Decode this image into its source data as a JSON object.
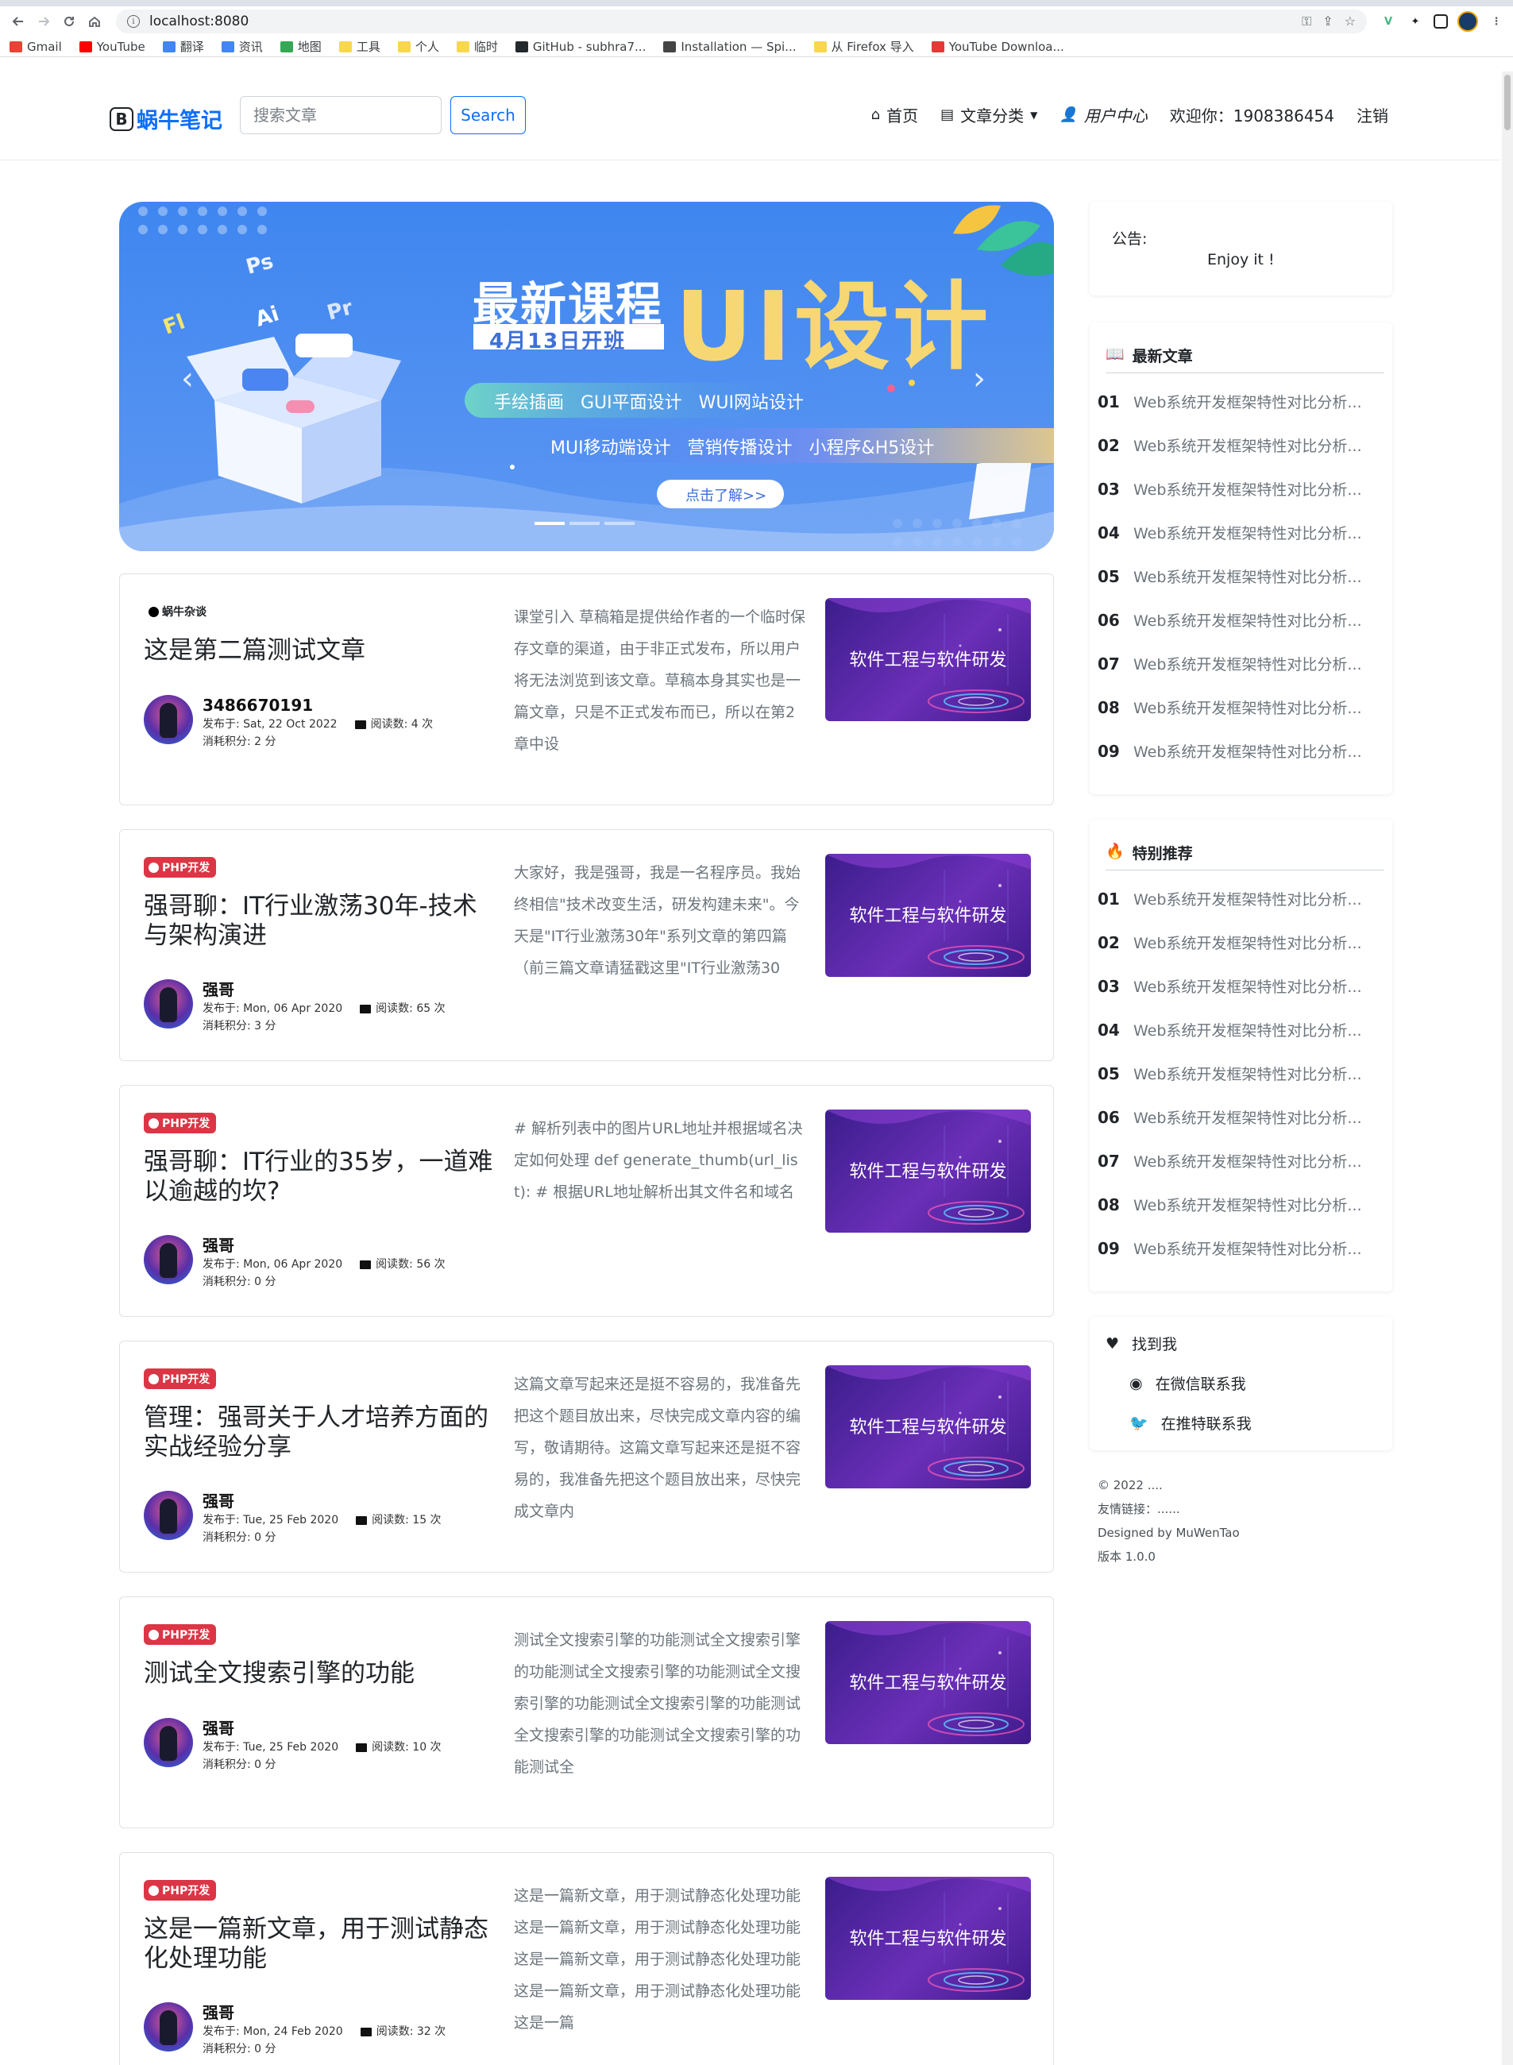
{
  "browser": {
    "url": "localhost:8080",
    "bookmarks": [
      {
        "label": "Gmail",
        "color": "#ea4335"
      },
      {
        "label": "YouTube",
        "color": "#ff0000"
      },
      {
        "label": "翻译",
        "color": "#4285f4"
      },
      {
        "label": "资讯",
        "color": "#4285f4"
      },
      {
        "label": "地图",
        "color": "#34a853"
      },
      {
        "label": "工具",
        "color": "#f9d74d"
      },
      {
        "label": "个人",
        "color": "#f9d74d"
      },
      {
        "label": "临时",
        "color": "#f9d74d"
      },
      {
        "label": "GitHub - subhra7...",
        "color": "#24292e"
      },
      {
        "label": "Installation — Spi...",
        "color": "#444"
      },
      {
        "label": "从 Firefox 导入",
        "color": "#f9d74d"
      },
      {
        "label": "YouTube Downloa...",
        "color": "#e53935"
      }
    ]
  },
  "site": {
    "brand_letter": "B",
    "brand_name": "蜗牛笔记",
    "search_placeholder": "搜索文章",
    "search_button": "Search",
    "nav": {
      "home": "首页",
      "categories": "文章分类",
      "user_center": "用户中心",
      "welcome": "欢迎你：1908386454",
      "logout": "注销"
    }
  },
  "banner": {
    "headline": "最新课程",
    "big_text": "UI设计",
    "date_ribbon": "4月13日开班",
    "line1": "手绘插画   GUI平面设计   WUI网站设计",
    "line2": "MUI移动端设计   营销传播设计   小程序&H5设计",
    "cta": "点击了解>>",
    "floating_labels": [
      "Fl",
      "Ps",
      "Ai",
      "Pr"
    ],
    "active_slide": 1,
    "slides": 3
  },
  "articles": [
    {
      "category": "蜗牛杂谈",
      "category_style": "dark",
      "title": "这是第二篇测试文章",
      "author": "3486670191",
      "published": "发布于: Sat, 22 Oct 2022",
      "reads": "阅读数: 4 次",
      "cost": "消耗积分: 2 分",
      "summary": "课堂引入 草稿箱是提供给作者的一个临时保存文章的渠道，由于非正式发布，所以用户将无法浏览到该文章。草稿本身其实也是一篇文章，只是不正式发布而已，所以在第2章中设",
      "thumb_label": "软件工程与软件研发"
    },
    {
      "category": "PHP开发",
      "category_style": "red",
      "title": "强哥聊：IT行业激荡30年-技术与架构演进",
      "author": "强哥",
      "published": "发布于: Mon, 06 Apr 2020",
      "reads": "阅读数: 65 次",
      "cost": "消耗积分: 3 分",
      "summary": "大家好，我是强哥，我是一名程序员。我始终相信\"技术改变生活，研发构建未来\"。今天是\"IT行业激荡30年\"系列文章的第四篇（前三篇文章请猛戳这里\"IT行业激荡30",
      "thumb_label": "软件工程与软件研发"
    },
    {
      "category": "PHP开发",
      "category_style": "red",
      "title": "强哥聊：IT行业的35岁，一道难以逾越的坎?",
      "author": "强哥",
      "published": "发布于: Mon, 06 Apr 2020",
      "reads": "阅读数: 56 次",
      "cost": "消耗积分: 0 分",
      "summary": "# 解析列表中的图片URL地址并根据域名决定如何处理 def generate_thumb(url_list): # 根据URL地址解析出其文件名和域名",
      "thumb_label": "软件工程与软件研发"
    },
    {
      "category": "PHP开发",
      "category_style": "red",
      "title": "管理：强哥关于人才培养方面的实战经验分享",
      "author": "强哥",
      "published": "发布于: Tue, 25 Feb 2020",
      "reads": "阅读数: 15 次",
      "cost": "消耗积分: 0 分",
      "summary": "这篇文章写起来还是挺不容易的，我准备先把这个题目放出来，尽快完成文章内容的编写，敬请期待。这篇文章写起来还是挺不容易的，我准备先把这个题目放出来，尽快完成文章内",
      "thumb_label": "软件工程与软件研发"
    },
    {
      "category": "PHP开发",
      "category_style": "red",
      "title": "测试全文搜索引擎的功能",
      "author": "强哥",
      "published": "发布于: Tue, 25 Feb 2020",
      "reads": "阅读数: 10 次",
      "cost": "消耗积分: 0 分",
      "summary": "测试全文搜索引擎的功能测试全文搜索引擎的功能测试全文搜索引擎的功能测试全文搜索引擎的功能测试全文搜索引擎的功能测试全文搜索引擎的功能测试全文搜索引擎的功能测试全",
      "thumb_label": "软件工程与软件研发"
    },
    {
      "category": "PHP开发",
      "category_style": "red",
      "title": "这是一篇新文章，用于测试静态化处理功能",
      "author": "强哥",
      "published": "发布于: Mon, 24 Feb 2020",
      "reads": "阅读数: 32 次",
      "cost": "消耗积分: 0 分",
      "summary": "这是一篇新文章，用于测试静态化处理功能这是一篇新文章，用于测试静态化处理功能这是一篇新文章，用于测试静态化处理功能这是一篇新文章，用于测试静态化处理功能这是一篇",
      "thumb_label": "软件工程与软件研发"
    }
  ],
  "sidebar": {
    "notice_label": "公告:",
    "notice_text": "Enjoy it !",
    "latest": {
      "title": "最新文章",
      "items": [
        {
          "num": "01",
          "text": "Web系统开发框架特性对比分析..."
        },
        {
          "num": "02",
          "text": "Web系统开发框架特性对比分析..."
        },
        {
          "num": "03",
          "text": "Web系统开发框架特性对比分析..."
        },
        {
          "num": "04",
          "text": "Web系统开发框架特性对比分析..."
        },
        {
          "num": "05",
          "text": "Web系统开发框架特性对比分析..."
        },
        {
          "num": "06",
          "text": "Web系统开发框架特性对比分析..."
        },
        {
          "num": "07",
          "text": "Web系统开发框架特性对比分析..."
        },
        {
          "num": "08",
          "text": "Web系统开发框架特性对比分析..."
        },
        {
          "num": "09",
          "text": "Web系统开发框架特性对比分析..."
        }
      ]
    },
    "featured": {
      "title": "特别推荐",
      "items": [
        {
          "num": "01",
          "text": "Web系统开发框架特性对比分析..."
        },
        {
          "num": "02",
          "text": "Web系统开发框架特性对比分析..."
        },
        {
          "num": "03",
          "text": "Web系统开发框架特性对比分析..."
        },
        {
          "num": "04",
          "text": "Web系统开发框架特性对比分析..."
        },
        {
          "num": "05",
          "text": "Web系统开发框架特性对比分析..."
        },
        {
          "num": "06",
          "text": "Web系统开发框架特性对比分析..."
        },
        {
          "num": "07",
          "text": "Web系统开发框架特性对比分析..."
        },
        {
          "num": "08",
          "text": "Web系统开发框架特性对比分析..."
        },
        {
          "num": "09",
          "text": "Web系统开发框架特性对比分析..."
        }
      ]
    },
    "find_me": {
      "title": "找到我",
      "wechat": "在微信联系我",
      "twitter": "在推特联系我"
    },
    "footer": {
      "copyright": "© 2022 ....",
      "links": "友情链接：......",
      "designed": "Designed by MuWenTao",
      "version": "版本 1.0.0"
    }
  }
}
